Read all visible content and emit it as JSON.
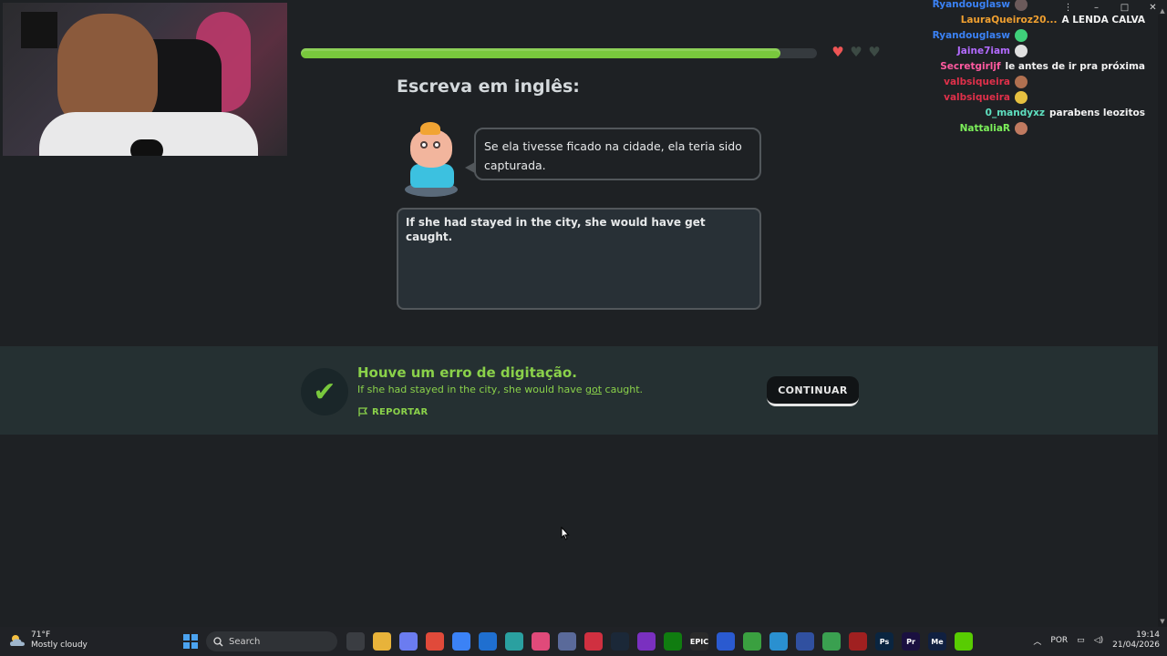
{
  "window": {
    "controls": [
      "–",
      "□",
      "✕"
    ],
    "menu": "⋮"
  },
  "lesson": {
    "progress_fraction": 0.93,
    "hearts": {
      "total": 3,
      "filled": 1
    },
    "prompt_title": "Escreva em inglês:",
    "source_sentence": "Se ela tivesse ficado na cidade, ela teria sido capturada.",
    "answer_text": "If she had stayed in the city, she would have get caught."
  },
  "feedback": {
    "title": "Houve um erro de digitação.",
    "correction_before": "If she had stayed in the city, she would have ",
    "correction_highlight": "got",
    "correction_after": " caught.",
    "report_label": "REPORTAR",
    "continue_label": "CONTINUAR",
    "colors": {
      "accent": "#8ad14a",
      "bar": "#253032"
    }
  },
  "chat": [
    {
      "user": "Ryandouglasw",
      "color": "#3b82f6",
      "message": "",
      "emote": "#6b5a5a"
    },
    {
      "user": "LauraQueiroz20...",
      "color": "#f0a030",
      "message": "A LENDA CALVA",
      "emote": ""
    },
    {
      "user": "Ryandouglasw",
      "color": "#3b82f6",
      "message": "",
      "emote": "#3fd07a"
    },
    {
      "user": "Jaine7iam",
      "color": "#b36bff",
      "message": "",
      "emote": "#e0e0e0"
    },
    {
      "user": "Secretgirljf",
      "color": "#ff5aa0",
      "message": "le antes de ir pra próxima",
      "emote": ""
    },
    {
      "user": "valbsiqueira",
      "color": "#e0304a",
      "message": "",
      "emote": "#b07050"
    },
    {
      "user": "valbsiqueira",
      "color": "#e0304a",
      "message": "",
      "emote": "#e6c040"
    },
    {
      "user": "0_mandyxz",
      "color": "#5fe0c0",
      "message": "parabens leozitos",
      "emote": ""
    },
    {
      "user": "NattaliaR",
      "color": "#7cf05a",
      "message": "",
      "emote": "#c07a60"
    }
  ],
  "taskbar": {
    "weather_temp": "71°F",
    "weather_desc": "Mostly cloudy",
    "search_placeholder": "Search",
    "lang": "POR",
    "time": "19:14",
    "date": "21/04/2026",
    "app_icons": [
      {
        "name": "task-view-icon",
        "color": "#3a3d42",
        "glyph": ""
      },
      {
        "name": "file-explorer-icon",
        "color": "#e8b33a",
        "glyph": ""
      },
      {
        "name": "copilot-icon",
        "color": "#6b7cf0",
        "glyph": ""
      },
      {
        "name": "chrome-icon",
        "color": "#e04a3a",
        "glyph": ""
      },
      {
        "name": "store-icon",
        "color": "#3b82f6",
        "glyph": ""
      },
      {
        "name": "outlook-icon",
        "color": "#1f6fd0",
        "glyph": ""
      },
      {
        "name": "app-icon",
        "color": "#2aa0a0",
        "glyph": ""
      },
      {
        "name": "app-icon",
        "color": "#e04a7a",
        "glyph": ""
      },
      {
        "name": "app-icon",
        "color": "#5a6a9a",
        "glyph": ""
      },
      {
        "name": "app-icon",
        "color": "#d03040",
        "glyph": ""
      },
      {
        "name": "steam-icon",
        "color": "#1b2838",
        "glyph": ""
      },
      {
        "name": "app-icon",
        "color": "#7a30c0",
        "glyph": ""
      },
      {
        "name": "xbox-icon",
        "color": "#107c10",
        "glyph": ""
      },
      {
        "name": "epic-icon",
        "color": "#2a2a2a",
        "glyph": "EPIC"
      },
      {
        "name": "app-icon",
        "color": "#2a5ad0",
        "glyph": ""
      },
      {
        "name": "app-icon",
        "color": "#3aa040",
        "glyph": ""
      },
      {
        "name": "app-icon",
        "color": "#2a90d0",
        "glyph": ""
      },
      {
        "name": "app-icon",
        "color": "#3050a0",
        "glyph": ""
      },
      {
        "name": "app-icon",
        "color": "#3aa050",
        "glyph": ""
      },
      {
        "name": "app-icon",
        "color": "#a02020",
        "glyph": ""
      },
      {
        "name": "photoshop-icon",
        "color": "#0a2540",
        "glyph": "Ps"
      },
      {
        "name": "premiere-icon",
        "color": "#1a1040",
        "glyph": "Pr"
      },
      {
        "name": "media-encoder-icon",
        "color": "#102040",
        "glyph": "Me"
      },
      {
        "name": "duolingo-icon",
        "color": "#58cc02",
        "glyph": ""
      }
    ]
  }
}
